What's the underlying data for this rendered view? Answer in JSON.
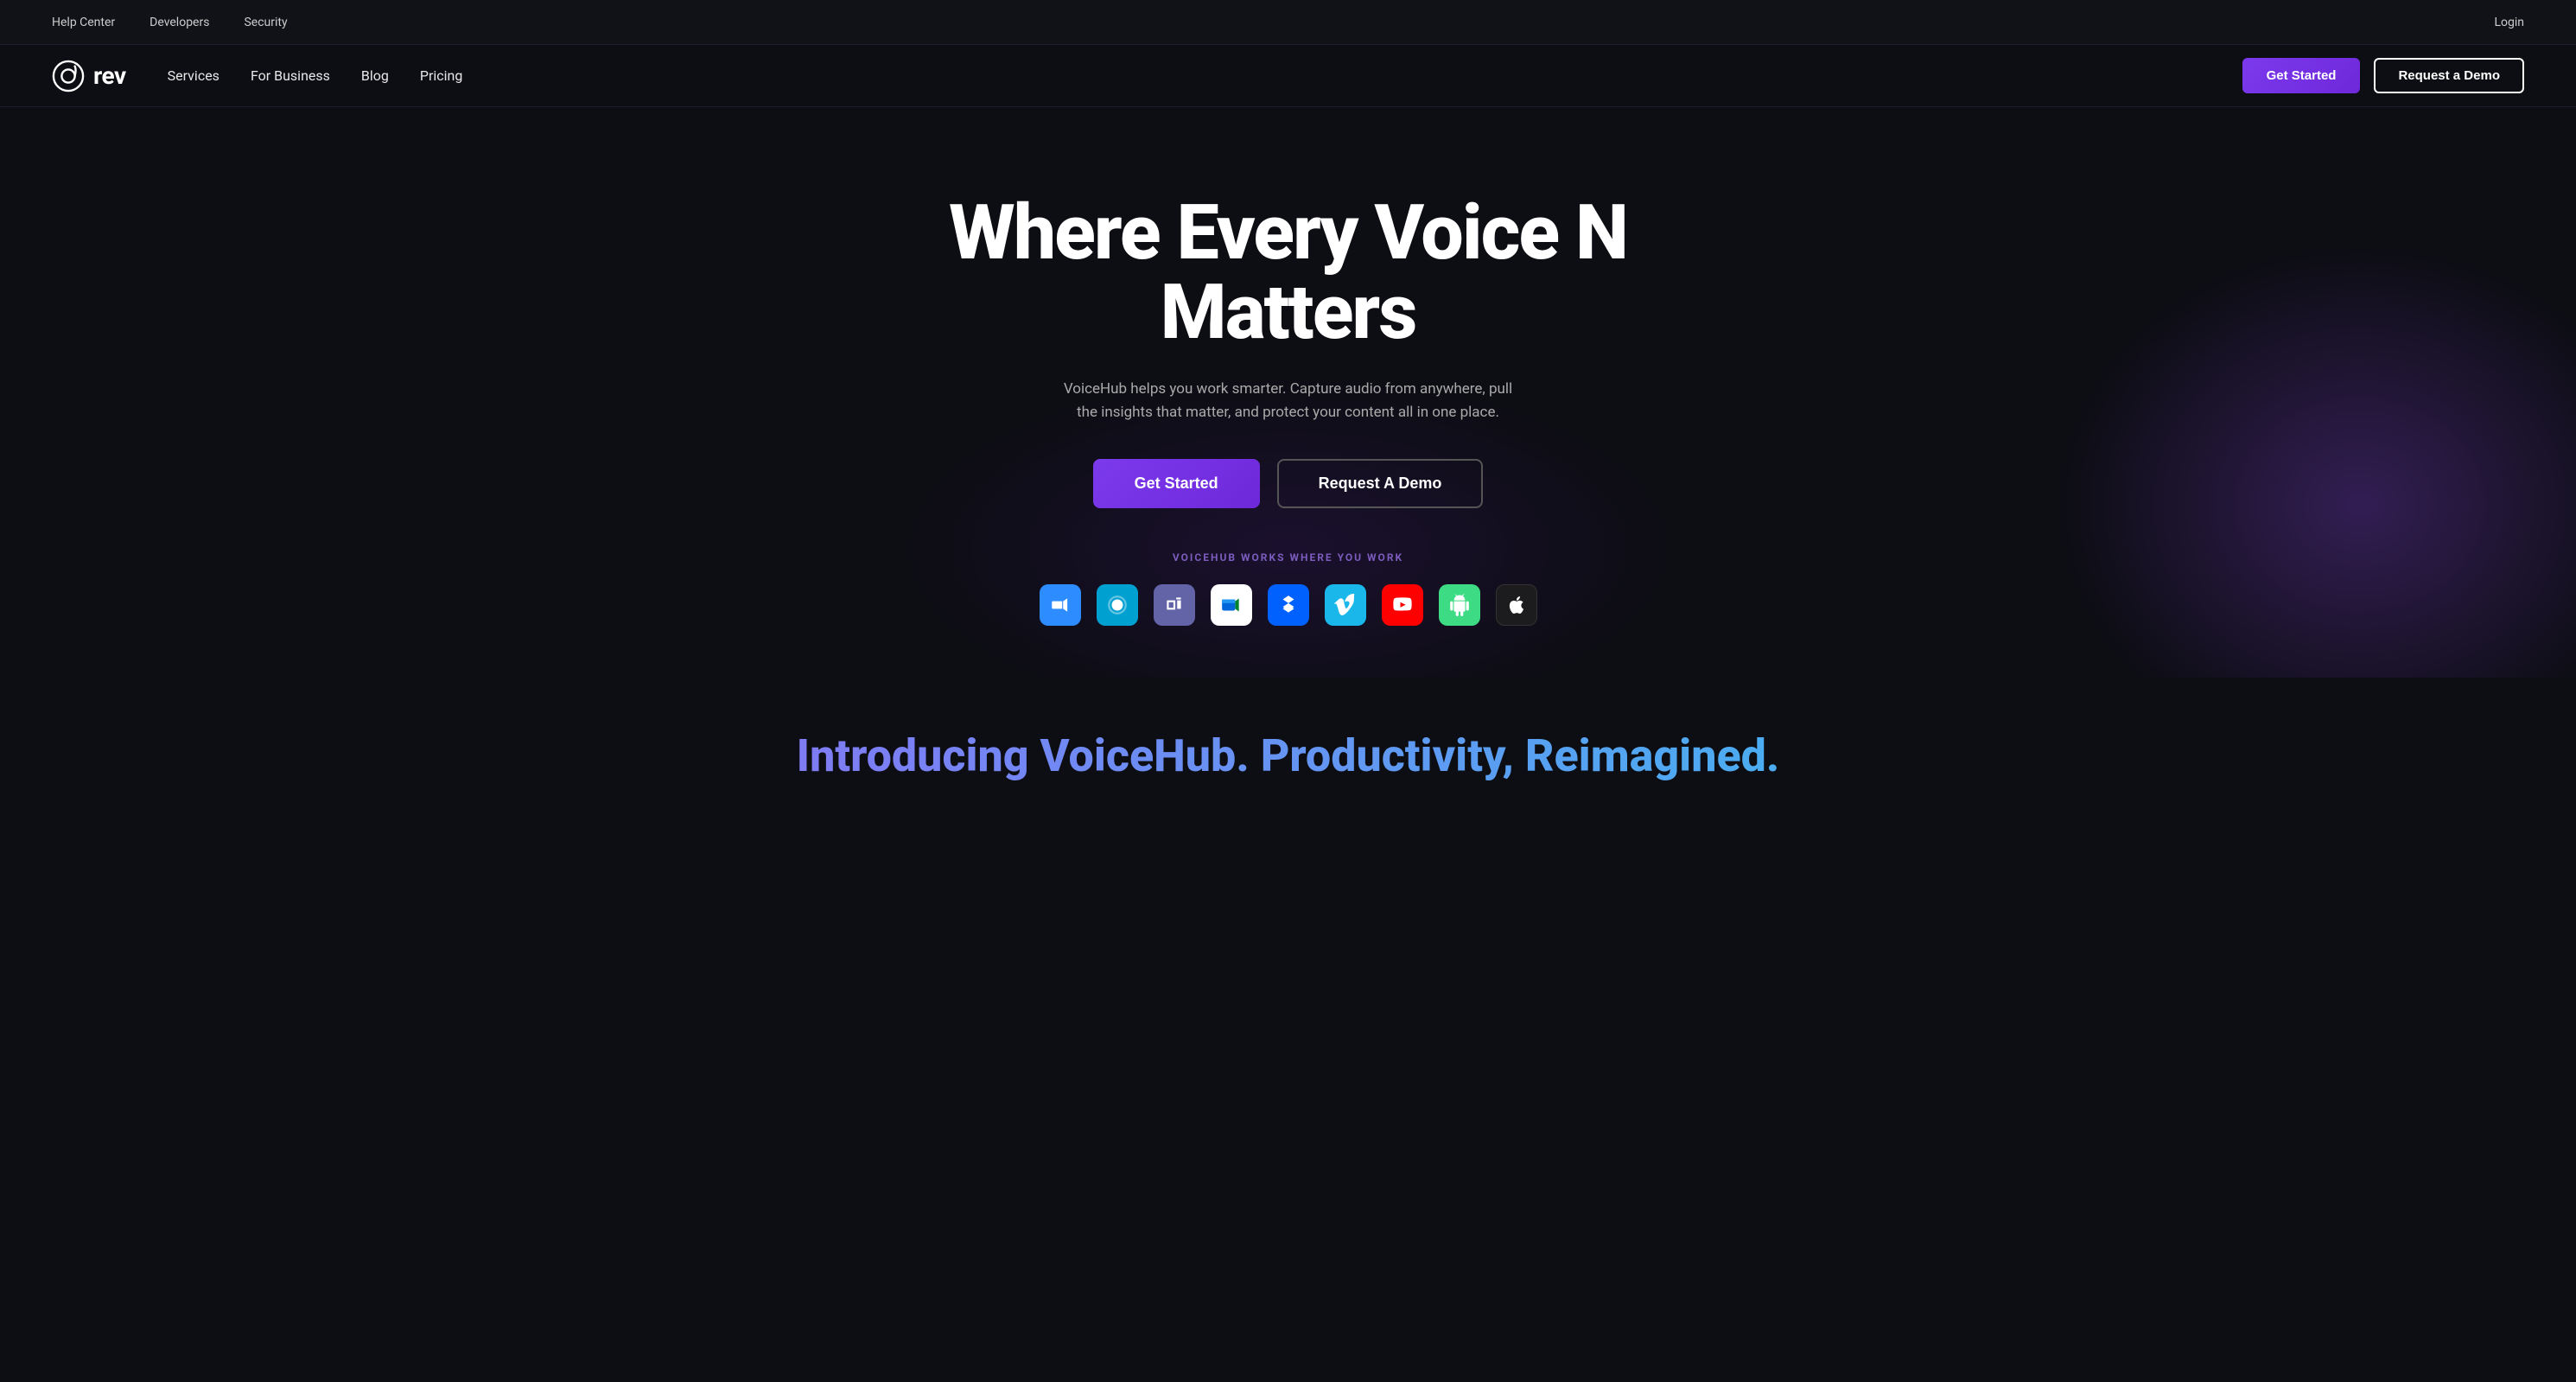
{
  "topbar": {
    "links": [
      "Help Center",
      "Developers",
      "Security"
    ],
    "login_label": "Login"
  },
  "nav": {
    "logo_text": "rev",
    "links": [
      "Services",
      "For Business",
      "Blog",
      "Pricing"
    ],
    "get_started_label": "Get Started",
    "request_demo_label": "Request a Demo"
  },
  "hero": {
    "title": "Where Every Voice N Matters",
    "subtitle": "VoiceHub helps you work smarter. Capture audio from anywhere, pull the insights that matter, and protect your content all in one place.",
    "cta_primary": "Get Started",
    "cta_secondary": "Request A Demo",
    "integrations_label": "VOICEHUB WORKS WHERE YOU WORK"
  },
  "integrations": [
    {
      "name": "Zoom",
      "icon": "zoom",
      "bg": "#2D8CFF"
    },
    {
      "name": "Webex",
      "icon": "webex",
      "bg": "#00a0d1"
    },
    {
      "name": "Teams",
      "icon": "teams",
      "bg": "#6264A7"
    },
    {
      "name": "Google Meet",
      "icon": "meet",
      "bg": "#ffffff"
    },
    {
      "name": "Dropbox",
      "icon": "dropbox",
      "bg": "#0061FF"
    },
    {
      "name": "Vimeo",
      "icon": "vimeo",
      "bg": "#1ab7ea"
    },
    {
      "name": "YouTube",
      "icon": "youtube",
      "bg": "#FF0000"
    },
    {
      "name": "Android",
      "icon": "android",
      "bg": "#3DDC84"
    },
    {
      "name": "Apple",
      "icon": "apple",
      "bg": "#1c1c1e"
    }
  ],
  "bottom": {
    "title": "Introducing VoiceHub. Productivity, Reimagined."
  }
}
